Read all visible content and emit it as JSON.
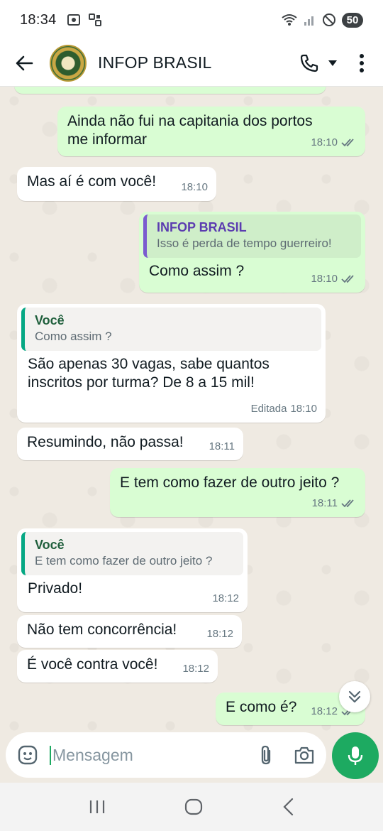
{
  "status_bar": {
    "time": "18:34",
    "battery": "50"
  },
  "header": {
    "contact_name": "INFOP BRASIL"
  },
  "messages": [
    {
      "dir": "out",
      "time": "",
      "partial": true
    },
    {
      "dir": "out",
      "text": "Ainda não fui na capitania dos portos me informar",
      "time": "18:10",
      "ticks": "read"
    },
    {
      "dir": "in",
      "text": "Mas aí é com você!",
      "time": "18:10"
    },
    {
      "dir": "out",
      "quote_author": "INFOP BRASIL",
      "quote_text": "Isso é perda de tempo guerreiro!",
      "text": "Como assim ?",
      "time": "18:10",
      "ticks": "read"
    },
    {
      "dir": "in",
      "quote_author": "Você",
      "quote_text": "Como assim ?",
      "text": "São apenas 30 vagas, sabe quantos inscritos por turma? De 8 a 15 mil!",
      "edited_label": "Editada",
      "time": "18:10"
    },
    {
      "dir": "in",
      "text": "Resumindo, não passa!",
      "time": "18:11"
    },
    {
      "dir": "out",
      "text": "E tem como fazer de outro jeito ?",
      "time": "18:11",
      "ticks": "read"
    },
    {
      "dir": "in",
      "quote_author": "Você",
      "quote_text": "E tem como fazer de outro jeito ?",
      "text": "Privado!",
      "time": "18:12"
    },
    {
      "dir": "in",
      "text": "Não tem concorrência!",
      "time": "18:12"
    },
    {
      "dir": "in",
      "text": "É você contra você!",
      "time": "18:12"
    },
    {
      "dir": "out",
      "text": "E como é?",
      "time": "18:12",
      "ticks": "read"
    }
  ],
  "composer": {
    "placeholder": "Mensagem"
  },
  "colors": {
    "accent": "#1daa61",
    "outgoing_bubble": "#d9fdd3",
    "incoming_bubble": "#ffffff",
    "chat_background": "#efeae2",
    "read_ticks": "#667781"
  }
}
